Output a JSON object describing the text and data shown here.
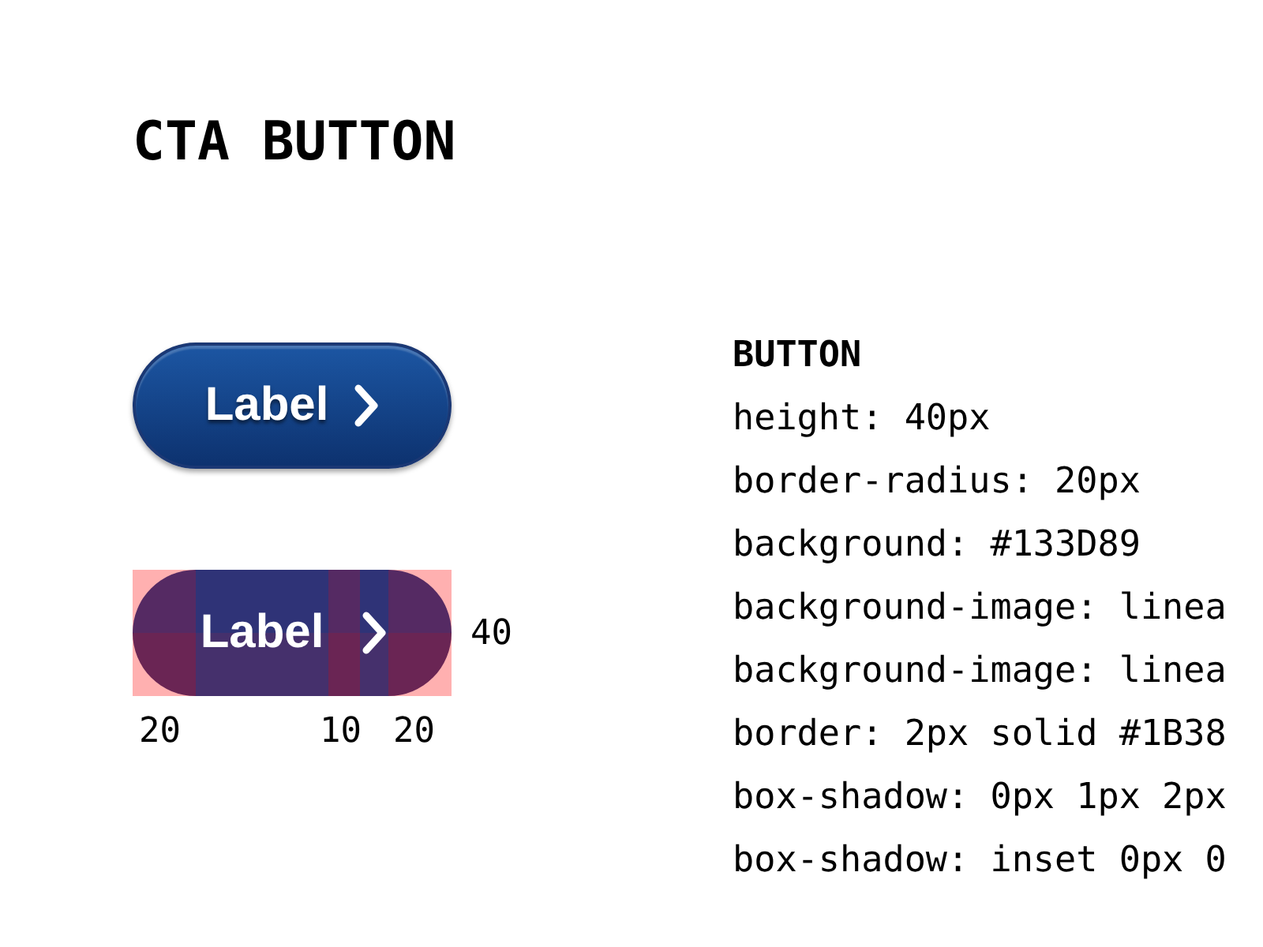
{
  "title": "CTA BUTTON",
  "button": {
    "label": "Label"
  },
  "diagram": {
    "label": "Label",
    "height_label": "40",
    "spacing_labels": [
      "20",
      "10",
      "20"
    ]
  },
  "spec": {
    "heading": "BUTTON",
    "lines": [
      "height: 40px",
      "border-radius: 20px",
      "background: #133D89",
      "background-image: linea",
      "background-image: linea",
      "border: 2px solid #1B38",
      "box-shadow: 0px 1px 2px",
      "box-shadow: inset 0px 0"
    ]
  }
}
